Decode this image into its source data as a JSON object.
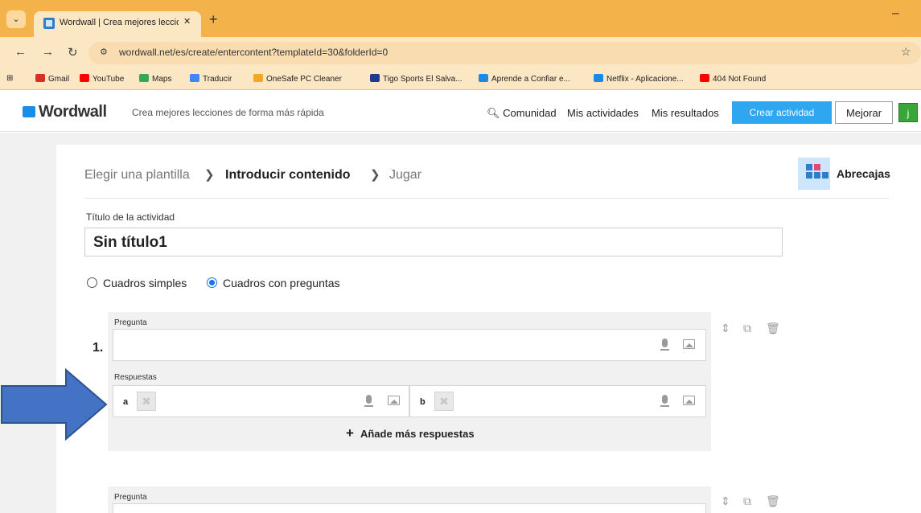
{
  "browser": {
    "tab_menu_icon": "chevron-down-icon",
    "tab_title": "Wordwall | Crea mejores leccion",
    "tab_close": "✕",
    "new_tab": "+",
    "minimize": "–",
    "url": "wordwall.net/es/create/entercontent?templateId=30&folderId=0",
    "bookmarks": [
      {
        "label": "Gmail",
        "color": "#d93025"
      },
      {
        "label": "YouTube",
        "color": "#ff0000"
      },
      {
        "label": "Maps",
        "color": "#34a853"
      },
      {
        "label": "Traducir",
        "color": "#4285f4"
      },
      {
        "label": "OneSafe PC Cleaner",
        "color": "#f5a623"
      },
      {
        "label": "Tigo Sports El Salva...",
        "color": "#1e3a8a"
      },
      {
        "label": "Aprende a Confiar e...",
        "color": "#1e88e5"
      },
      {
        "label": "Netflix - Aplicacione...",
        "color": "#1e88e5"
      },
      {
        "label": "404 Not Found",
        "color": "#ff0000"
      }
    ]
  },
  "header": {
    "logo": "Wordwall",
    "tagline": "Crea mejores lecciones de forma más rápida",
    "links": [
      "Comunidad",
      "Mis actividades",
      "Mis resultados"
    ],
    "create_button": "Crear actividad",
    "upgrade_button": "Mejorar",
    "avatar_letter": "j"
  },
  "breadcrumb": {
    "step1": "Elegir una plantilla",
    "step2": "Introducir contenido",
    "step3": "Jugar",
    "separator": "❯"
  },
  "template_name": "Abrecajas",
  "activity_title_label": "Título de la actividad",
  "activity_title_value": "Sin título1",
  "mode_options": [
    {
      "label": "Cuadros simples",
      "selected": false
    },
    {
      "label": "Cuadros con preguntas",
      "selected": true
    }
  ],
  "questions": [
    {
      "number": "1.",
      "question_label": "Pregunta",
      "question_value": "",
      "answers_label": "Respuestas",
      "answers": [
        {
          "letter": "a",
          "value": ""
        },
        {
          "letter": "b",
          "value": ""
        }
      ],
      "add_more_label": "Añade más respuestas"
    },
    {
      "question_label": "Pregunta"
    }
  ],
  "accent_colors": {
    "browser_frame": "#f4b24a",
    "create_button": "#2ea6f0",
    "arrow": "#4472c4",
    "avatar": "#3aa63a"
  }
}
